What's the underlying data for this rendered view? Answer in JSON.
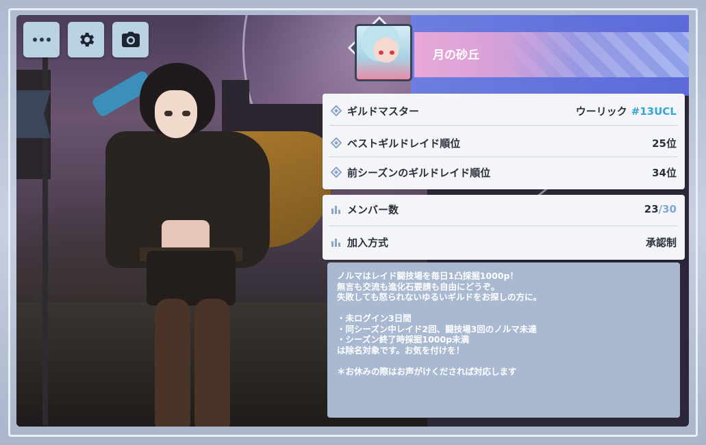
{
  "toolbar": {
    "buttons": [
      {
        "icon": "more-icon"
      },
      {
        "icon": "gear-icon"
      },
      {
        "icon": "camera-icon"
      }
    ]
  },
  "guild": {
    "name": "月の砂丘",
    "master_label": "ギルドマスター",
    "master_name": "ウーリック",
    "master_tag": "#13UCL",
    "best_rank_label": "ベストギルドレイド順位",
    "best_rank_value": "25位",
    "prev_rank_label": "前シーズンのギルドレイド順位",
    "prev_rank_value": "34位",
    "members_label": "メンバー数",
    "members_current": "23",
    "members_max": "/30",
    "join_label": "加入方式",
    "join_value": "承認制",
    "description": "ノルマはレイド闘技場を毎日1凸採掘1000p！\n無言も交流も進化石要請も自由にどうぞ。\n失敗しても怒られないゆるいギルドをお探しの方に。\n\n・未ログイン3日間\n・同シーズン中レイド2回、闘技場3回のノルマ未達\n・シーズン終了時採掘1000p未満\nは除名対象です。お気を付けを！\n\n＊お休みの際はお声がけくだされば対応します"
  },
  "colors": {
    "accent_blue": "#33a6d8",
    "banner_pink": "#e8a8d8",
    "panel_bg": "#f4f5f8",
    "desc_bg": "#a9b9d1"
  }
}
